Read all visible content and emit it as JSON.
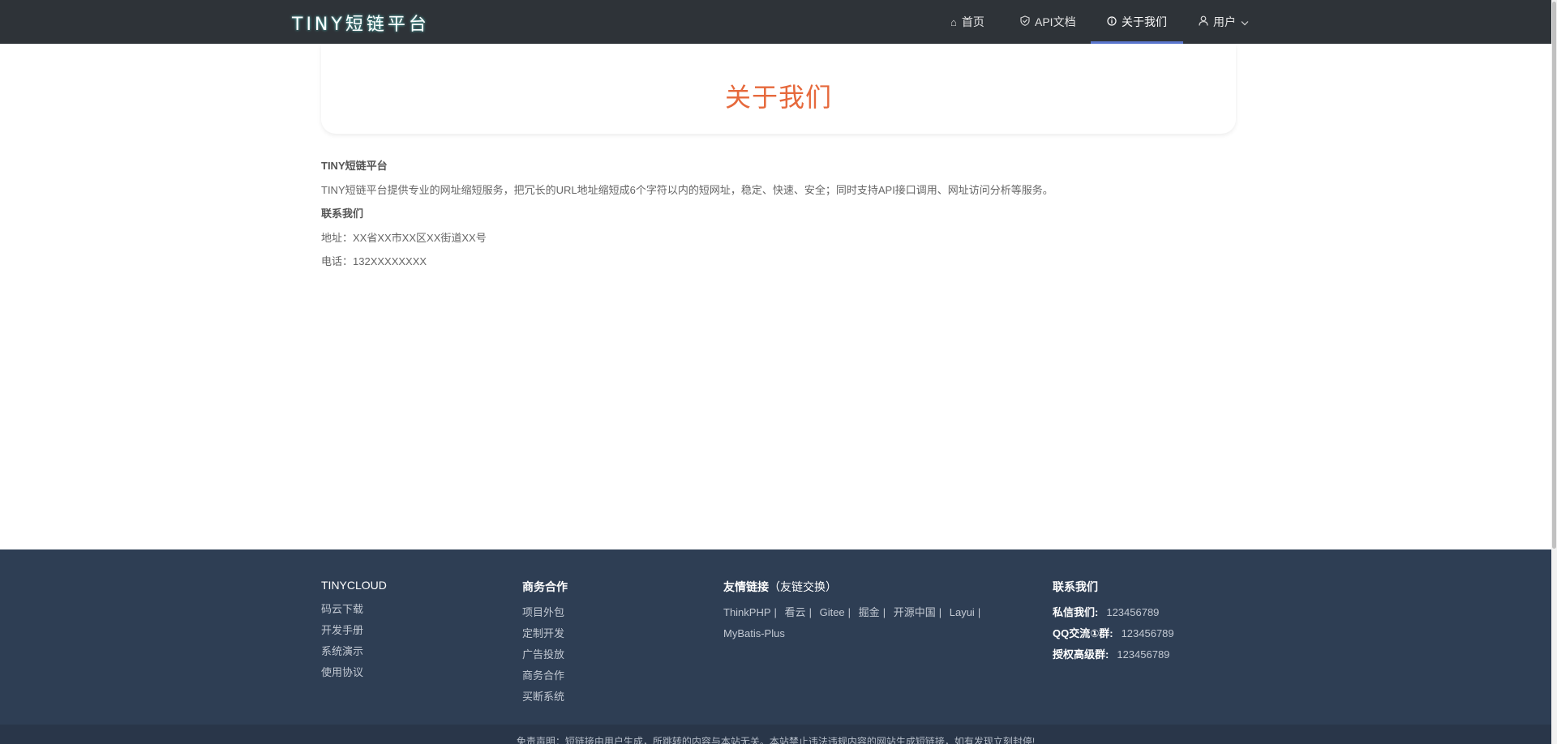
{
  "header": {
    "logo": "TINY短链平台",
    "nav": {
      "home": "首页",
      "api": "API文档",
      "about": "关于我们",
      "user": "用户"
    },
    "icons": {
      "home": "home-icon",
      "api": "shield-check-icon",
      "about": "info-circle-icon",
      "user": "user-icon",
      "chevron": "chevron-down-icon"
    },
    "active_color": "#5b77cf"
  },
  "main": {
    "title": "关于我们",
    "title_color": "#e6693c",
    "section1_heading": "TINY短链平台",
    "section1_text": "TINY短链平台提供专业的网址缩短服务，把冗长的URL地址缩短成6个字符以内的短网址，稳定、快速、安全；同时支持API接口调用、网址访问分析等服务。",
    "section2_heading": "联系我们",
    "address": "地址：XX省XX市XX区XX街道XX号",
    "phone": "电话：132XXXXXXXX"
  },
  "footer": {
    "col1": {
      "heading": "TINYCLOUD",
      "items": [
        "码云下载",
        "开发手册",
        "系统演示",
        "使用协议"
      ]
    },
    "col2": {
      "heading": "商务合作",
      "items": [
        "项目外包",
        "定制开发",
        "广告投放",
        "商务合作",
        "买断系统"
      ]
    },
    "col3": {
      "heading": "友情链接",
      "heading_note": "（友链交换）",
      "links": [
        "ThinkPHP",
        "看云",
        "Gitee",
        "掘金",
        "开源中国",
        "Layui",
        "MyBatis-Plus"
      ],
      "separator": "|"
    },
    "col4": {
      "heading": "联系我们",
      "rows": [
        {
          "label": "私信我们:",
          "value": "123456789"
        },
        {
          "label": "QQ交流①群:",
          "value": "123456789"
        },
        {
          "label": "授权高级群:",
          "value": "123456789"
        }
      ]
    },
    "bottom_text": "免责声明：短链接由用户生成，所跳转的内容与本站无关。本站禁止违法违规内容的网站生成短链接，如有发现立刻封停!",
    "bg_color": "#2e3e54"
  }
}
